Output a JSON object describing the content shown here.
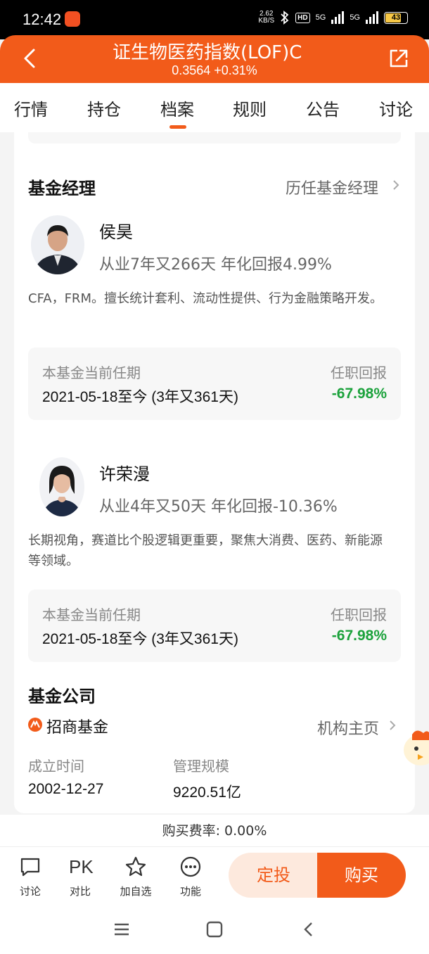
{
  "status": {
    "time": "12:42",
    "net_speed_value": "2.62",
    "net_speed_unit": "KB/S",
    "hd": "HD",
    "sig1": "5G",
    "sig2": "5G",
    "battery": "43"
  },
  "header": {
    "title": "证生物医药指数(LOF)C",
    "price": "0.3564 +0.31%"
  },
  "tabs": [
    {
      "label": "行情"
    },
    {
      "label": "持仓"
    },
    {
      "label": "档案",
      "active": true
    },
    {
      "label": "规则"
    },
    {
      "label": "公告"
    },
    {
      "label": "讨论"
    }
  ],
  "managers_section": {
    "title": "基金经理",
    "history_link": "历任基金经理"
  },
  "managers": [
    {
      "name": "侯昊",
      "experience": "从业7年又266天 年化回报4.99%",
      "description": "CFA，FRM。擅长统计套利、流动性提供、行为金融策略开发。",
      "tenure_label": "本基金当前任期",
      "return_label": "任职回报",
      "tenure": "2021-05-18至今 (3年又361天)",
      "return": "-67.98%"
    },
    {
      "name": "许荣漫",
      "experience": "从业4年又50天 年化回报-10.36%",
      "description": "长期视角，赛道比个股逻辑更重要，聚焦大消费、医药、新能源等领域。",
      "tenure_label": "本基金当前任期",
      "return_label": "任职回报",
      "tenure": "2021-05-18至今 (3年又361天)",
      "return": "-67.98%"
    }
  ],
  "company": {
    "title": "基金公司",
    "name": "招商基金",
    "link": "机构主页",
    "founded_label": "成立时间",
    "founded": "2002-12-27",
    "aum_label": "管理规模",
    "aum": "9220.51亿"
  },
  "fee": {
    "text": "购买费率: 0.00%"
  },
  "bottom": {
    "discuss": "讨论",
    "pk_icon": "PK",
    "compare": "对比",
    "watch": "加自选",
    "more": "功能",
    "sip": "定投",
    "buy": "购买"
  },
  "colors": {
    "accent": "#f25b1a",
    "negative": "#1ca23c"
  }
}
